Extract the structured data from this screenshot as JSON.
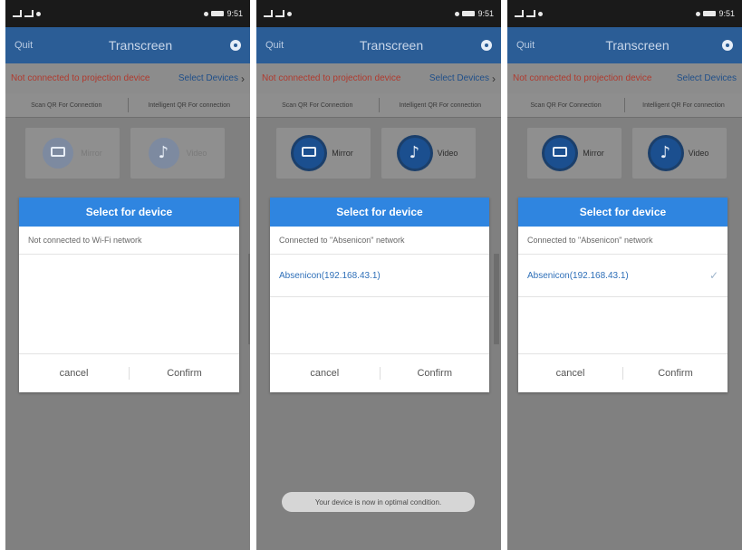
{
  "panels": [
    {
      "app_title": "Transcreen",
      "quit_label": "Quit",
      "status_time": "9:51",
      "connection_status": "Not connected to projection device",
      "select_devices_label": "Select Devices",
      "scan_qr_label": "Scan QR For Connection",
      "intelligent_qr_label": "Intelligent QR For connection",
      "tiles": [
        {
          "label": "Mirror",
          "icon": "mirror-icon"
        },
        {
          "label": "Video",
          "icon": "video-icon"
        }
      ],
      "dialog": {
        "title": "Select for device",
        "network_text": "Not connected to Wi-Fi network",
        "devices": [],
        "cancel_label": "cancel",
        "confirm_label": "Confirm"
      }
    },
    {
      "app_title": "Transcreen",
      "quit_label": "Quit",
      "status_time": "9:51",
      "connection_status": "Not connected to projection device",
      "select_devices_label": "Select Devices",
      "scan_qr_label": "Scan QR For Connection",
      "intelligent_qr_label": "Intelligent QR For connection",
      "tiles": [
        {
          "label": "Mirror",
          "icon": "mirror-icon"
        },
        {
          "label": "Video",
          "icon": "video-icon"
        }
      ],
      "dialog": {
        "title": "Select for device",
        "network_text": "Connected to \"Absenicon\" network",
        "devices": [
          {
            "name": "Absenicon(192.168.43.1)",
            "selected": false
          }
        ],
        "cancel_label": "cancel",
        "confirm_label": "Confirm"
      },
      "toast": "Your device is now in optimal condition."
    },
    {
      "app_title": "Transcreen",
      "quit_label": "Quit",
      "status_time": "9:51",
      "connection_status": "Not connected to projection device",
      "select_devices_label": "Select Devices",
      "scan_qr_label": "Scan QR For Connection",
      "intelligent_qr_label": "Intelligent QR For connection",
      "tiles": [
        {
          "label": "Mirror",
          "icon": "mirror-icon"
        },
        {
          "label": "Video",
          "icon": "video-icon"
        }
      ],
      "dialog": {
        "title": "Select for device",
        "network_text": "Connected to \"Absenicon\" network",
        "devices": [
          {
            "name": "Absenicon(192.168.43.1)",
            "selected": true
          }
        ],
        "cancel_label": "cancel",
        "confirm_label": "Confirm"
      }
    }
  ],
  "colors": {
    "app_bar": "#2b5d96",
    "dialog_title": "#2f85e0",
    "device_text": "#2e6fb8",
    "connection_status": "#b03a2e",
    "overlay": "#808080"
  }
}
